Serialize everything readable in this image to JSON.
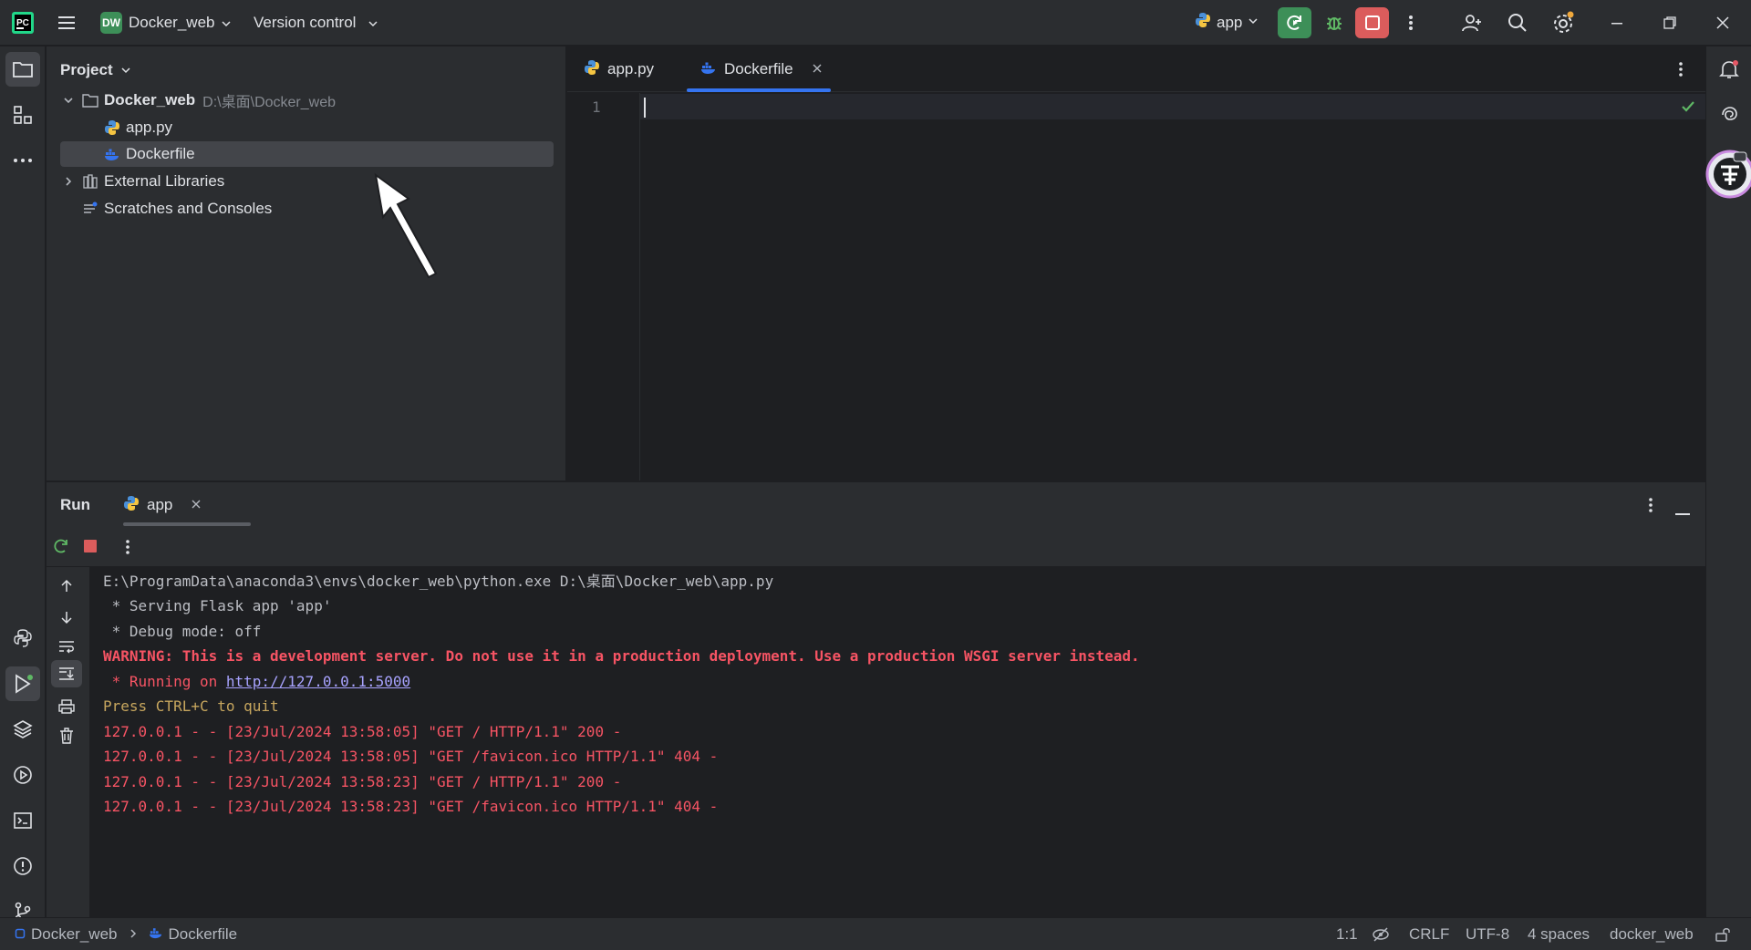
{
  "titlebar": {
    "project_badge": "DW",
    "project_name": "Docker_web",
    "version_control": "Version control",
    "run_config": "app"
  },
  "project_panel": {
    "title": "Project",
    "root_name": "Docker_web",
    "root_path": "D:\\桌面\\Docker_web",
    "files": [
      "app.py",
      "Dockerfile"
    ],
    "external_libraries": "External Libraries",
    "scratches": "Scratches and Consoles"
  },
  "editor": {
    "tabs": [
      "app.py",
      "Dockerfile"
    ],
    "active_tab": "Dockerfile",
    "line_number": "1"
  },
  "run_panel": {
    "title": "Run",
    "tab_label": "app",
    "console": {
      "command": "E:\\ProgramData\\anaconda3\\envs\\docker_web\\python.exe D:\\桌面\\Docker_web\\app.py",
      "serving": " * Serving Flask app 'app'",
      "debug": " * Debug mode: off",
      "warning": "WARNING: This is a development server. Do not use it in a production deployment. Use a production WSGI server instead.",
      "running_prefix": " * Running on ",
      "running_url": "http://127.0.0.1:5000",
      "quit": "Press CTRL+C to quit",
      "logs": [
        "127.0.0.1 - - [23/Jul/2024 13:58:05] \"GET / HTTP/1.1\" 200 -",
        "127.0.0.1 - - [23/Jul/2024 13:58:05] \"GET /favicon.ico HTTP/1.1\" 404 -",
        "127.0.0.1 - - [23/Jul/2024 13:58:23] \"GET / HTTP/1.1\" 200 -",
        "127.0.0.1 - - [23/Jul/2024 13:58:23] \"GET /favicon.ico HTTP/1.1\" 404 -"
      ]
    }
  },
  "statusbar": {
    "breadcrumb_project": "Docker_web",
    "breadcrumb_file": "Dockerfile",
    "position": "1:1",
    "line_separator": "CRLF",
    "encoding": "UTF-8",
    "indent": "4 spaces",
    "interpreter": "docker_web"
  },
  "colors": {
    "accent": "#3574f0",
    "run_green": "#3d8f58",
    "stop_red": "#db5c5c",
    "warning_red": "#f75464",
    "link_purple": "#a8a3ff"
  }
}
